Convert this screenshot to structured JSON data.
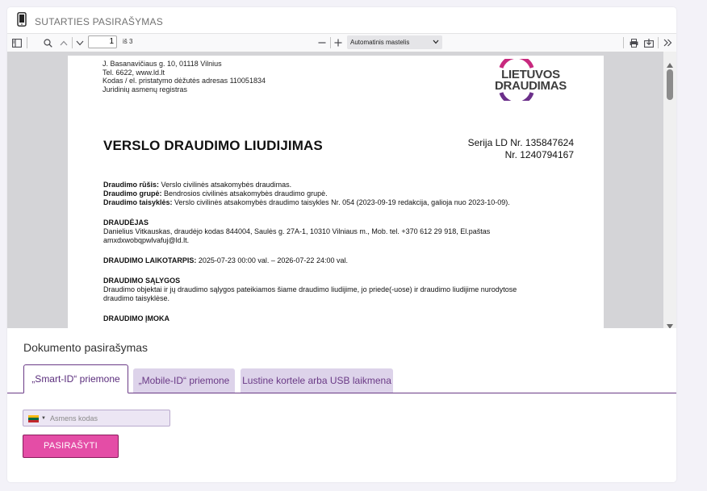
{
  "header": {
    "title": "SUTARTIES PASIRAŠYMAS"
  },
  "toolbar": {
    "page_current": "1",
    "page_total": "iš 3",
    "zoom": "Automatinis mastelis"
  },
  "document": {
    "address_lines": [
      "J. Basanavičiaus g. 10, 01118 Vilnius",
      "Tel. 6622, www.ld.lt",
      "Kodas / el. pristatymo dėžutės adresas 110051834",
      "Juridinių asmenų registras"
    ],
    "logo_line1": "LIETUVOS",
    "logo_line2": "DRAUDIMAS",
    "title": "VERSLO DRAUDIMO LIUDIJIMAS",
    "serija_line1": "Serija LD  Nr. 135847624",
    "serija_line2": "Nr. 1240794167",
    "rusis_label": "Draudimo rūšis:",
    "rusis_value": " Verslo civilinės atsakomybės draudimas.",
    "grupe_label": "Draudimo grupė:",
    "grupe_value": " Bendrosios civilinės atsakomybės draudimo grupė.",
    "taisykles_label": "Draudimo taisyklės:",
    "taisykles_value": " Verslo civilinės atsakomybės draudimo taisykles Nr. 054 (2023-09-19 redakcija, galioja nuo 2023-10-09).",
    "draudejas_heading": "DRAUDĖJAS",
    "draudejas_line1": "Danielius Vitkauskas, draudėjo kodas 844004, Saulės g. 27A-1, 10310 Vilniaus m., Mob. tel. +370 612 29 918, El.paštas",
    "draudejas_line2": "amxdxwobqpwlvafuj@ld.lt.",
    "laikotarpis_label": "DRAUDIMO LAIKOTARPIS:",
    "laikotarpis_value": " 2025-07-23 00:00 val. – 2026-07-22 24:00 val.",
    "salygos_heading": "DRAUDIMO SĄLYGOS",
    "salygos_line1": "Draudimo objektai ir jų draudimo sąlygos pateikiamos šiame draudimo liudijime, jo priede(-uose) ir draudimo liudijime nurodytose",
    "salygos_line2": "draudimo taisyklėse.",
    "imoka_heading": "DRAUDIMO ĮMOKA"
  },
  "signing": {
    "title": "Dokumento pasirašymas",
    "tabs": [
      {
        "label": "„Smart-ID“ priemone"
      },
      {
        "label": "„Mobile-ID“ priemone"
      },
      {
        "label": "Lustine kortele arba USB laikmena"
      }
    ],
    "input_placeholder": "Asmens kodas",
    "sign_button": "PASIRAŠYTI"
  },
  "colors": {
    "accent": "#6a3a86",
    "tab_bg": "#ddd3ea",
    "button": "#e44da6",
    "logo_magenta": "#c8297e",
    "logo_purple": "#6b2f8a"
  },
  "icons": [
    "phone-icon",
    "sidebar-toggle-icon",
    "search-icon",
    "chevron-up-icon",
    "chevron-down-icon",
    "zoom-out-icon",
    "zoom-in-icon",
    "print-icon",
    "download-icon",
    "double-chevron-right-icon",
    "flag-lt-icon"
  ]
}
